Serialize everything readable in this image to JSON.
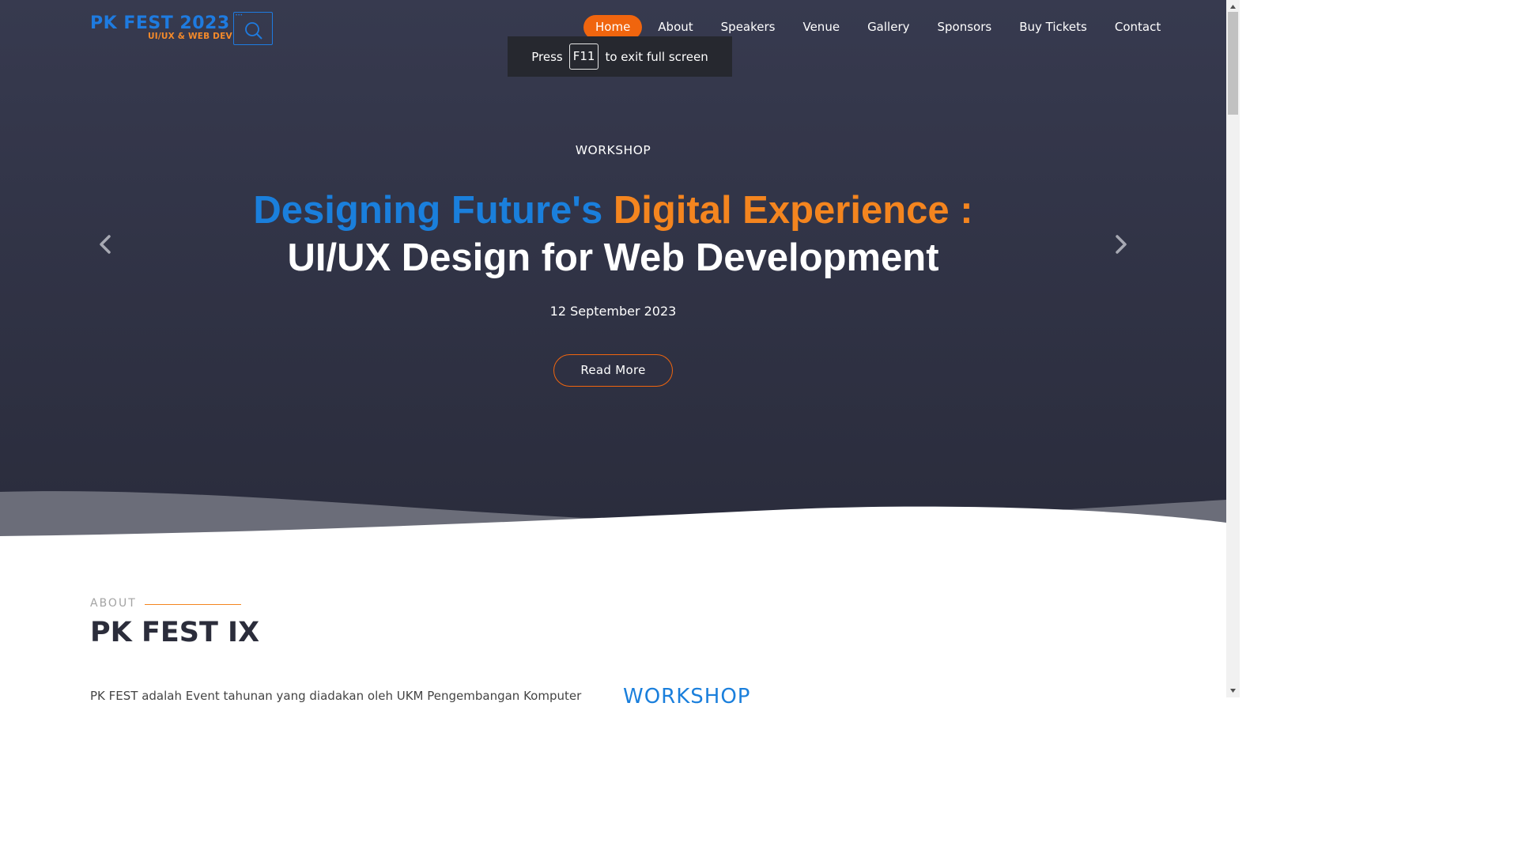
{
  "logo": {
    "main_part1": "PK FEST",
    "main_part2": "2023",
    "subtitle": "UI/UX & WEB DEV",
    "icon": "browser-search-icon"
  },
  "nav": {
    "items": [
      {
        "label": "Home",
        "active": true
      },
      {
        "label": "About"
      },
      {
        "label": "Speakers"
      },
      {
        "label": "Venue"
      },
      {
        "label": "Gallery"
      },
      {
        "label": "Sponsors"
      },
      {
        "label": "Buy Tickets"
      },
      {
        "label": "Contact"
      }
    ]
  },
  "fullscreen_toast": {
    "before": "Press",
    "key": "F11",
    "after": "to exit full screen"
  },
  "hero": {
    "subtitle": "WORKSHOP",
    "headline_blue": "Designing Future's",
    "headline_orange": "Digital Experience :",
    "headline_white": "UI/UX Design for Web Development",
    "date": "12 September 2023",
    "button": "Read More",
    "prev_icon": "chevron-left-icon",
    "next_icon": "chevron-right-icon"
  },
  "about": {
    "label": "ABOUT",
    "title": "PK FEST IX",
    "text": "PK FEST adalah Event tahunan yang diadakan oleh UKM Pengembangan Komputer",
    "workshop_label": "WORKSHOP"
  },
  "colors": {
    "accent_orange": "#f0650e",
    "brand_blue": "#1a7fdc",
    "brand_orange": "#f4851f",
    "hero_bg": "#2f3142"
  }
}
